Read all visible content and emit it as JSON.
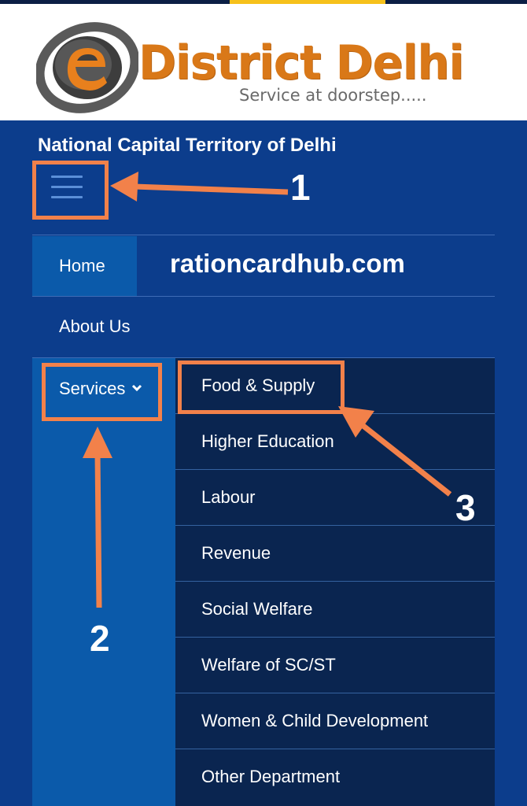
{
  "header": {
    "brand_title": "District Delhi",
    "brand_tagline": "Service at doorstep.....",
    "logo_icon": "e-globe-logo",
    "brand_color": "#d97818"
  },
  "region_title": "National Capital Territory of Delhi",
  "menu_icon": "hamburger-icon",
  "nav": {
    "home": "Home",
    "about": "About Us",
    "services": "Services",
    "services_chevron": "chevron-down-icon"
  },
  "watermark": "rationcardhub.com",
  "submenu": [
    "Food & Supply",
    "Higher Education",
    "Labour",
    "Revenue",
    "Social Welfare",
    "Welfare of SC/ST",
    "Women & Child Development",
    "Other Department"
  ],
  "callouts": {
    "one": "1",
    "two": "2",
    "three": "3"
  },
  "colors": {
    "page_bg": "#0c3d8c",
    "active_nav": "#0b5aaa",
    "submenu_bg": "#0a2550",
    "annotation": "#f2814a"
  }
}
